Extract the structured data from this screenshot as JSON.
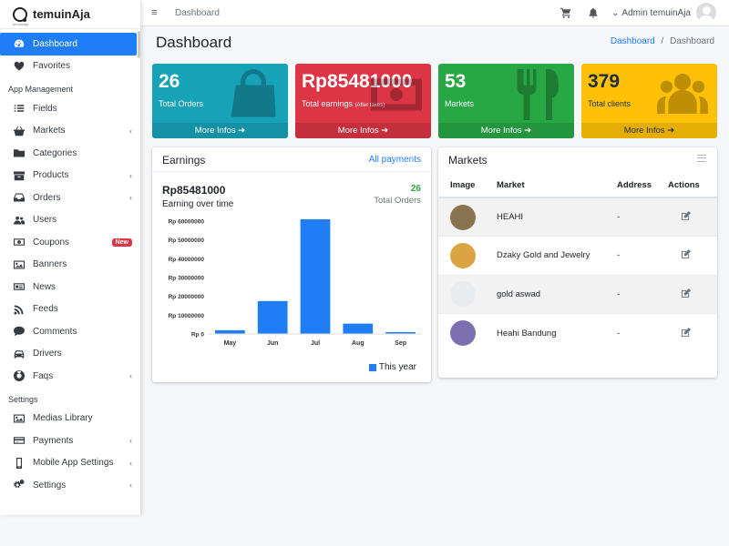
{
  "brand": {
    "name": "temuinAja",
    "sub": "temuinaja"
  },
  "sidebar": {
    "items_top": [
      {
        "label": "Dashboard",
        "icon": "dashboard-icon",
        "active": true
      },
      {
        "label": "Favorites",
        "icon": "heart-icon"
      }
    ],
    "section_app": "App Management",
    "items_app": [
      {
        "label": "Fields",
        "icon": "list-icon"
      },
      {
        "label": "Markets",
        "icon": "basket-icon",
        "chevron": "‹"
      },
      {
        "label": "Categories",
        "icon": "folder-icon"
      },
      {
        "label": "Products",
        "icon": "archive-icon",
        "chevron": "‹"
      },
      {
        "label": "Orders",
        "icon": "inbox-icon",
        "chevron": "‹"
      },
      {
        "label": "Users",
        "icon": "users-icon"
      },
      {
        "label": "Coupons",
        "icon": "money-icon",
        "badge": "New"
      },
      {
        "label": "Banners",
        "icon": "image-icon"
      },
      {
        "label": "News",
        "icon": "newspaper-icon"
      },
      {
        "label": "Feeds",
        "icon": "rss-icon"
      },
      {
        "label": "Comments",
        "icon": "comment-icon"
      },
      {
        "label": "Drivers",
        "icon": "car-icon"
      },
      {
        "label": "Faqs",
        "icon": "lifering-icon",
        "chevron": "‹"
      }
    ],
    "section_settings": "Settings",
    "items_settings": [
      {
        "label": "Medias Library",
        "icon": "image-icon"
      },
      {
        "label": "Payments",
        "icon": "credit-card-icon",
        "chevron": "‹"
      },
      {
        "label": "Mobile App Settings",
        "icon": "mobile-icon",
        "chevron": "‹"
      },
      {
        "label": "Settings",
        "icon": "cogs-icon",
        "chevron": "‹"
      }
    ]
  },
  "topbar": {
    "menu_glyph": "≡",
    "link": "Dashboard",
    "user": "Admin temuinAja",
    "caret": "⌄"
  },
  "page": {
    "title": "Dashboard",
    "breadcrumb_home": "Dashboard",
    "breadcrumb_sep": "/",
    "breadcrumb_current": "Dashboard"
  },
  "stats": [
    {
      "value": "26",
      "label": "Total Orders",
      "more": "More Infos ➔",
      "color": "#17a2b8",
      "icon": "shopping-bag-icon"
    },
    {
      "value": "Rp85481000",
      "label": "Total earnings",
      "note": "(After taxes)",
      "more": "More Infos ➔",
      "color": "#dc3545",
      "icon": "money-bill-icon"
    },
    {
      "value": "53",
      "label": "Markets",
      "more": "More Infos ➔",
      "color": "#28a745",
      "icon": "utensils-icon"
    },
    {
      "value": "379",
      "label": "Total clients",
      "more": "More Infos ➔",
      "color": "#ffc107",
      "icon": "users-icon"
    }
  ],
  "earnings": {
    "title": "Earnings",
    "link": "All payments",
    "amount": "Rp85481000",
    "subtitle": "Earning over time",
    "count": "26",
    "count_label": "Total Orders",
    "legend": "This year"
  },
  "chart_data": {
    "type": "bar",
    "categories": [
      "May",
      "Jun",
      "Jul",
      "Aug",
      "Sep"
    ],
    "series": [
      {
        "name": "This year",
        "values": [
          2000000,
          17500000,
          61000000,
          5500000,
          1000000
        ],
        "color": "#1f7ef5"
      }
    ],
    "ylim": [
      0,
      60000000
    ],
    "yticks": [
      0,
      10000000,
      20000000,
      30000000,
      40000000,
      50000000,
      60000000
    ],
    "ytick_labels": [
      "Rp 0",
      "Rp 10000000",
      "Rp 20000000",
      "Rp 30000000",
      "Rp 40000000",
      "Rp 50000000",
      "Rp 60000000"
    ],
    "title": "",
    "xlabel": "",
    "ylabel": "",
    "grid": false,
    "legend": "bottom-right"
  },
  "markets": {
    "title": "Markets",
    "headers": [
      "Image",
      "Market",
      "Address",
      "Actions"
    ],
    "rows": [
      {
        "name": "HEAHI",
        "address": "-",
        "thumb": "#8a7350"
      },
      {
        "name": "Dzaky Gold and Jewelry",
        "address": "-",
        "thumb": "#d9a441"
      },
      {
        "name": "gold aswad",
        "address": "-",
        "thumb": "#e9ecef"
      },
      {
        "name": "Heahi Bandung",
        "address": "-",
        "thumb": "#7b6fb0"
      }
    ]
  }
}
